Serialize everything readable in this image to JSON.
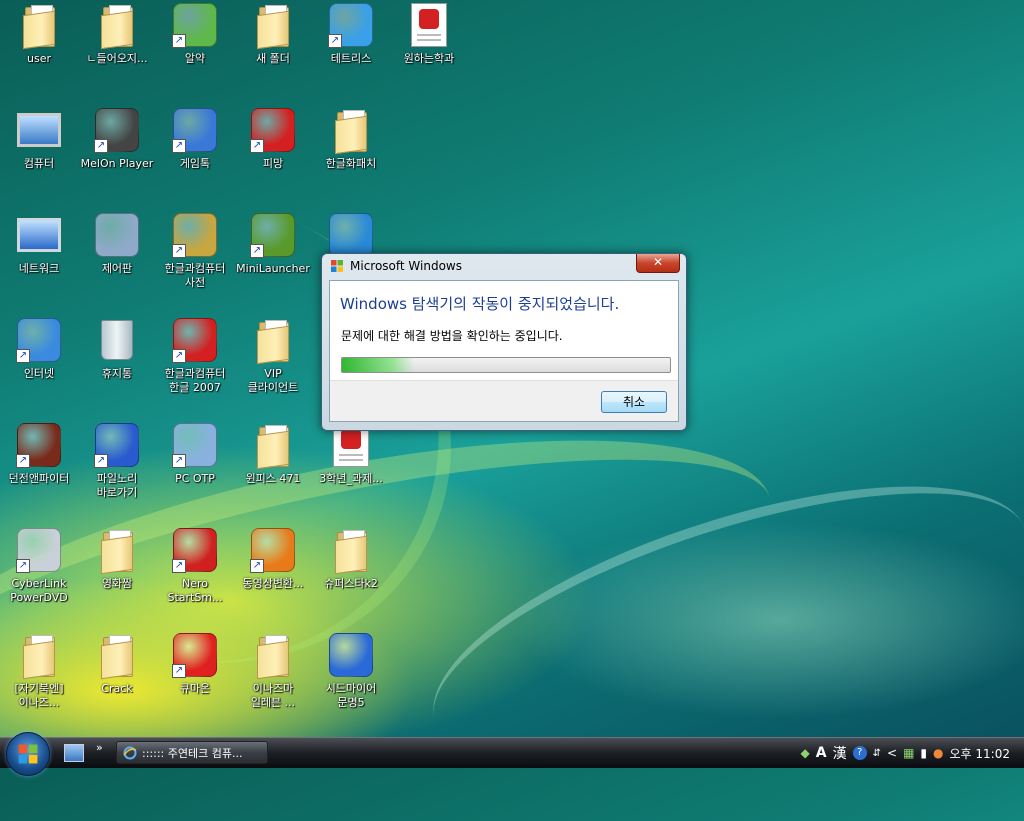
{
  "desktop": {
    "icons": [
      {
        "label": "user",
        "kind": "folder-user",
        "shortcut": false
      },
      {
        "label": "ㄴ들어오지...",
        "kind": "folder",
        "shortcut": false
      },
      {
        "label": "알약",
        "kind": "alyac",
        "shortcut": true
      },
      {
        "label": "새 폴더",
        "kind": "folder",
        "shortcut": false
      },
      {
        "label": "테트리스",
        "kind": "tetris",
        "shortcut": true
      },
      {
        "label": "원하는학과",
        "kind": "hwp-doc",
        "shortcut": false
      },
      {
        "label": "컴퓨터",
        "kind": "computer",
        "shortcut": false
      },
      {
        "label": "MelOn Player",
        "kind": "melon",
        "shortcut": true
      },
      {
        "label": "게임톡",
        "kind": "gametalk",
        "shortcut": true
      },
      {
        "label": "피망",
        "kind": "pmang",
        "shortcut": true
      },
      {
        "label": "한글화패치",
        "kind": "folder",
        "shortcut": false
      },
      {
        "label": "네트워크",
        "kind": "network",
        "shortcut": false
      },
      {
        "label": "제어판",
        "kind": "controlpanel",
        "shortcut": false
      },
      {
        "label": "한글과컴퓨터\n사전",
        "kind": "hancom-dict",
        "shortcut": true
      },
      {
        "label": "MiniLauncher",
        "kind": "minilauncher",
        "shortcut": true
      },
      {
        "label": "",
        "kind": "cloud",
        "shortcut": false
      },
      {
        "label": "인터넷",
        "kind": "ie",
        "shortcut": true
      },
      {
        "label": "휴지통",
        "kind": "recycle",
        "shortcut": false
      },
      {
        "label": "한글과컴퓨터\n한글 2007",
        "kind": "hwp2007",
        "shortcut": true
      },
      {
        "label": "VIP\n클라이언트",
        "kind": "folder",
        "shortcut": false
      },
      {
        "label": "던전앤파이터",
        "kind": "dnf",
        "shortcut": true
      },
      {
        "label": "파일노리\n바로가기",
        "kind": "filenori",
        "shortcut": true
      },
      {
        "label": "PC OTP",
        "kind": "pcotp",
        "shortcut": true
      },
      {
        "label": "윈피스 471",
        "kind": "folder",
        "shortcut": false
      },
      {
        "label": "3학년_과제...",
        "kind": "hwp-doc",
        "shortcut": false
      },
      {
        "label": "CyberLink\nPowerDVD",
        "kind": "powerdvd",
        "shortcut": true
      },
      {
        "label": "영화짬",
        "kind": "folder",
        "shortcut": false
      },
      {
        "label": "Nero\nStartSm...",
        "kind": "nero",
        "shortcut": true
      },
      {
        "label": "동영상변환...",
        "kind": "show",
        "shortcut": true
      },
      {
        "label": "슈퍼스타k2",
        "kind": "folder",
        "shortcut": false
      },
      {
        "label": "[자기북엔]\n이나즈...",
        "kind": "folder",
        "shortcut": false
      },
      {
        "label": "Crack",
        "kind": "folder",
        "shortcut": false
      },
      {
        "label": "큐마온",
        "kind": "qmaon",
        "shortcut": true
      },
      {
        "label": "이나즈마\n일레븐 ...",
        "kind": "folder",
        "shortcut": false
      },
      {
        "label": "시드마이어\n문명5",
        "kind": "zip",
        "shortcut": false
      }
    ]
  },
  "dialog": {
    "title": "Microsoft Windows",
    "close_label": "✕",
    "heading": "Windows 탐색기의 작동이 중지되었습니다.",
    "message": "문제에 대한 해결 방법을 확인하는 중입니다.",
    "progress_fraction": 0.22,
    "cancel_label": "취소"
  },
  "taskbar": {
    "quicklaunch_chevron": "»",
    "task_label": ":::::: 주연테크 컴퓨...",
    "tray": {
      "ime_a": "A",
      "ime_hanja": "漢",
      "help": "?",
      "chevron": "<",
      "clock": "오후 11:02"
    }
  },
  "colors": {
    "heading_blue": "#1c3f94",
    "close_red": "#c8452c",
    "progress_green": "#28b428"
  }
}
